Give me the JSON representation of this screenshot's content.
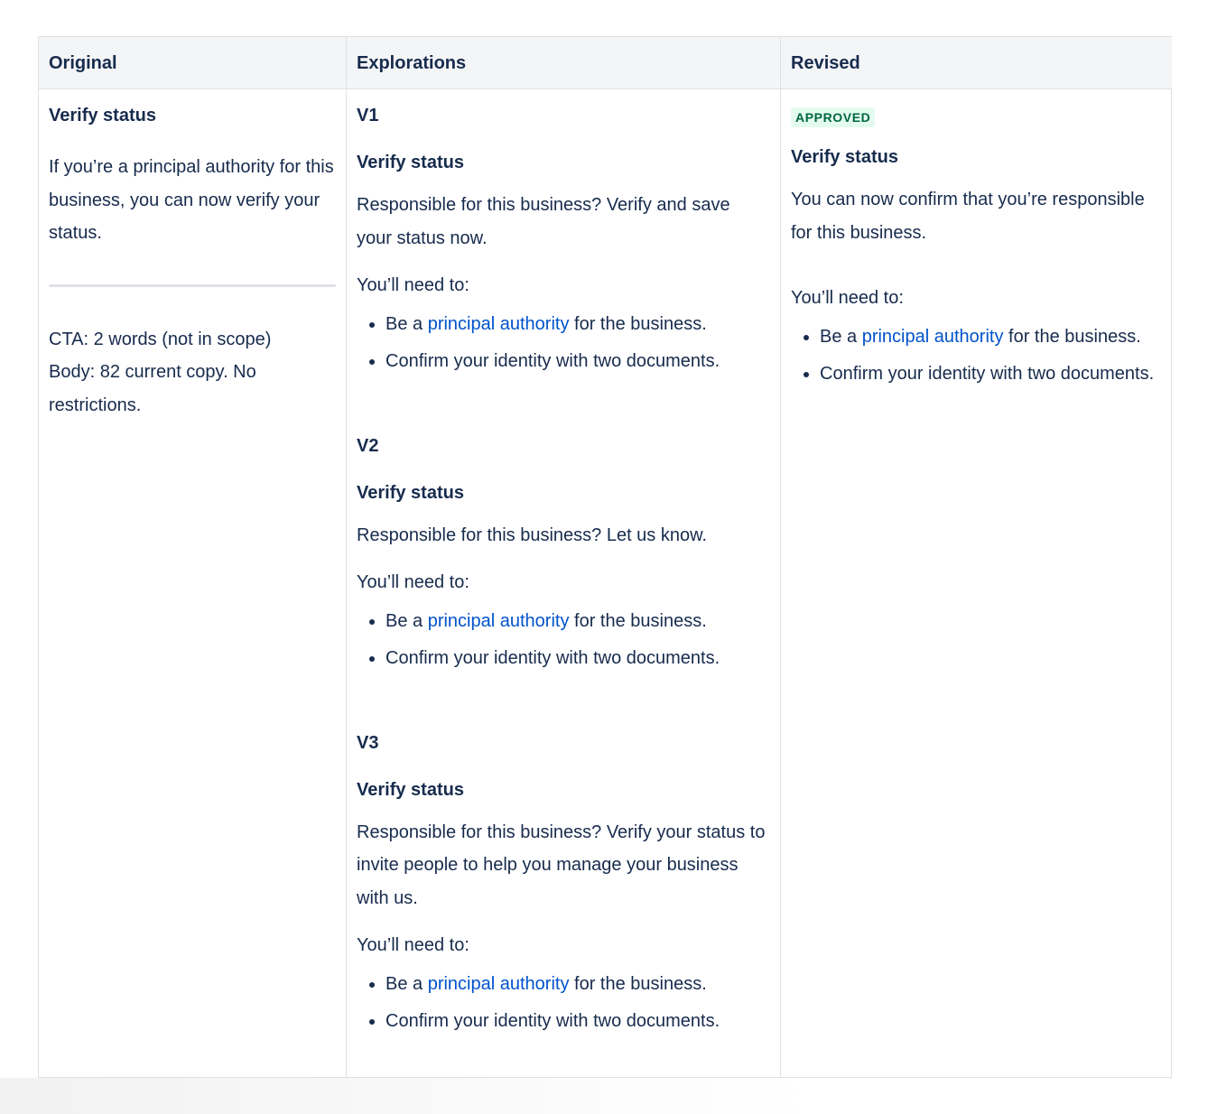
{
  "headers": {
    "original": "Original",
    "explorations": "Explorations",
    "revised": "Revised"
  },
  "original": {
    "title": "Verify status",
    "body": "If you’re a principal authority for this business, you can now verify your status.",
    "note_cta": "CTA: 2 words (not in scope)",
    "note_body": "Body: 82 current copy. No restrictions."
  },
  "explorations": {
    "v1": {
      "label": "V1",
      "title": "Verify status",
      "body": "Responsible for this business? Verify and save your status now.",
      "need": "You’ll need to:",
      "bullet1_pre": "Be a ",
      "bullet1_link": "principal authority",
      "bullet1_post": " for the business.",
      "bullet2": "Confirm your identity with two documents."
    },
    "v2": {
      "label": "V2",
      "title": "Verify status",
      "body": "Responsible for this business? Let us know.",
      "need": "You’ll need to:",
      "bullet1_pre": "Be a ",
      "bullet1_link": "principal authority",
      "bullet1_post": " for the business.",
      "bullet2": "Confirm your identity with two documents."
    },
    "v3": {
      "label": "V3",
      "title": "Verify status",
      "body": "Responsible for this business? Verify your status to invite people to help you manage your business with us.",
      "need": "You’ll need to:",
      "bullet1_pre": "Be a ",
      "bullet1_link": "principal authority",
      "bullet1_post": " for the business.",
      "bullet2": "Confirm your identity with two documents."
    }
  },
  "revised": {
    "badge": "APPROVED",
    "title": "Verify status",
    "body": "You can now confirm that you’re responsible for this business.",
    "need": "You’ll need to:",
    "bullet1_pre": "Be a ",
    "bullet1_link": "principal authority",
    "bullet1_post": " for the business.",
    "bullet2": "Confirm your identity with two documents."
  },
  "colors": {
    "text": "#172b4d",
    "link": "#0052cc",
    "header_bg": "#f4f5f7",
    "badge_bg": "#e3fcef",
    "badge_text": "#006644"
  }
}
